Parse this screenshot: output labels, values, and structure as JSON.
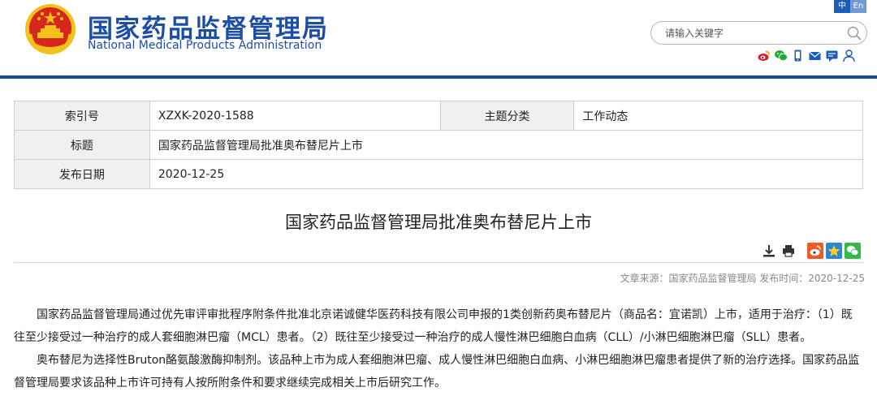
{
  "header": {
    "brand_cn": "国家药品监督管理局",
    "brand_en": "National Medical Products Administration",
    "lang_zh": "中",
    "lang_en": "En",
    "search_placeholder": "请输入关键字",
    "social_icons": [
      "weibo-icon",
      "wechat-icon",
      "mobile-icon",
      "mail-icon",
      "chat-icon",
      "user-icon"
    ]
  },
  "info": {
    "index_label": "索引号",
    "index_value": "XZXK-2020-1588",
    "category_label": "主题分类",
    "category_value": "工作动态",
    "title_label": "标题",
    "title_value": "国家药品监督管理局批准奥布替尼片上市",
    "date_label": "发布日期",
    "date_value": "2020-12-25"
  },
  "article": {
    "title": "国家药品监督管理局批准奥布替尼片上市",
    "source_line": "文章来源：国家药品监督管理局 发布时间：2020-12-25",
    "paragraph_1": "国家药品监督管理局通过优先审评审批程序附条件批准北京诺诚健华医药科技有限公司申报的1类创新药奥布替尼片（商品名：宜诺凯）上市，适用于治疗：（1）既往至少接受过一种治疗的成人套细胞淋巴瘤（MCL）患者。（2）既往至少接受过一种治疗的成人慢性淋巴细胞白血病（CLL）/小淋巴细胞淋巴瘤（SLL）患者。",
    "paragraph_2": "奥布替尼为选择性Bruton酪氨酸激酶抑制剂。该品种上市为成人套细胞淋巴瘤、成人慢性淋巴细胞白血病、小淋巴细胞淋巴瘤患者提供了新的治疗选择。国家药品监督管理局要求该品种上市许可持有人按所附条件和要求继续完成相关上市后研究工作。"
  },
  "colors": {
    "brand_blue": "#1d4ea6",
    "header_rule": "#1b4a9a",
    "emblem_red": "#d7261c",
    "emblem_gold": "#f2c21a"
  }
}
